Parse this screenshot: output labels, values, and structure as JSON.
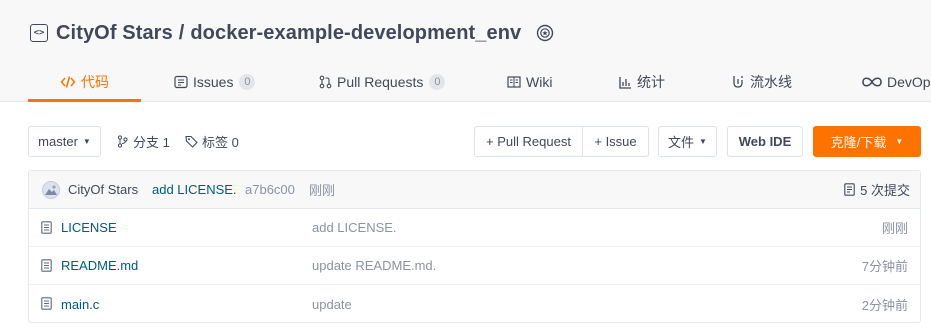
{
  "repo": {
    "owner": "CityOf Stars",
    "separator": "/",
    "name": "docker-example-development_env"
  },
  "tabs": [
    {
      "label": "代码",
      "icon": "code-icon",
      "active": true
    },
    {
      "label": "Issues",
      "icon": "issues-icon",
      "count": "0"
    },
    {
      "label": "Pull Requests",
      "icon": "pull-request-icon",
      "count": "0"
    },
    {
      "label": "Wiki",
      "icon": "wiki-icon"
    },
    {
      "label": "统计",
      "icon": "stats-icon"
    },
    {
      "label": "流水线",
      "icon": "pipeline-icon"
    },
    {
      "label": "DevOp",
      "icon": "devops-icon"
    }
  ],
  "toolbar": {
    "branch": "master",
    "branches": "分支 1",
    "tags": "标签 0",
    "pull_request": "+ Pull Request",
    "issue": "+ Issue",
    "file": "文件",
    "web_ide": "Web IDE",
    "clone": "克隆/下载"
  },
  "commit": {
    "author": "CityOf Stars",
    "message": "add LICENSE.",
    "sha": "a7b6c00",
    "time": "刚刚",
    "count": "5 次提交"
  },
  "files": [
    {
      "name": "LICENSE",
      "message": "add LICENSE.",
      "time": "刚刚"
    },
    {
      "name": "README.md",
      "message": "update README.md.",
      "time": "7分钟前"
    },
    {
      "name": "main.c",
      "message": "update",
      "time": "2分钟前"
    }
  ],
  "colors": {
    "accent": "#fe7300",
    "link": "#005980",
    "text": "#40485b",
    "muted": "#8c92a4"
  }
}
